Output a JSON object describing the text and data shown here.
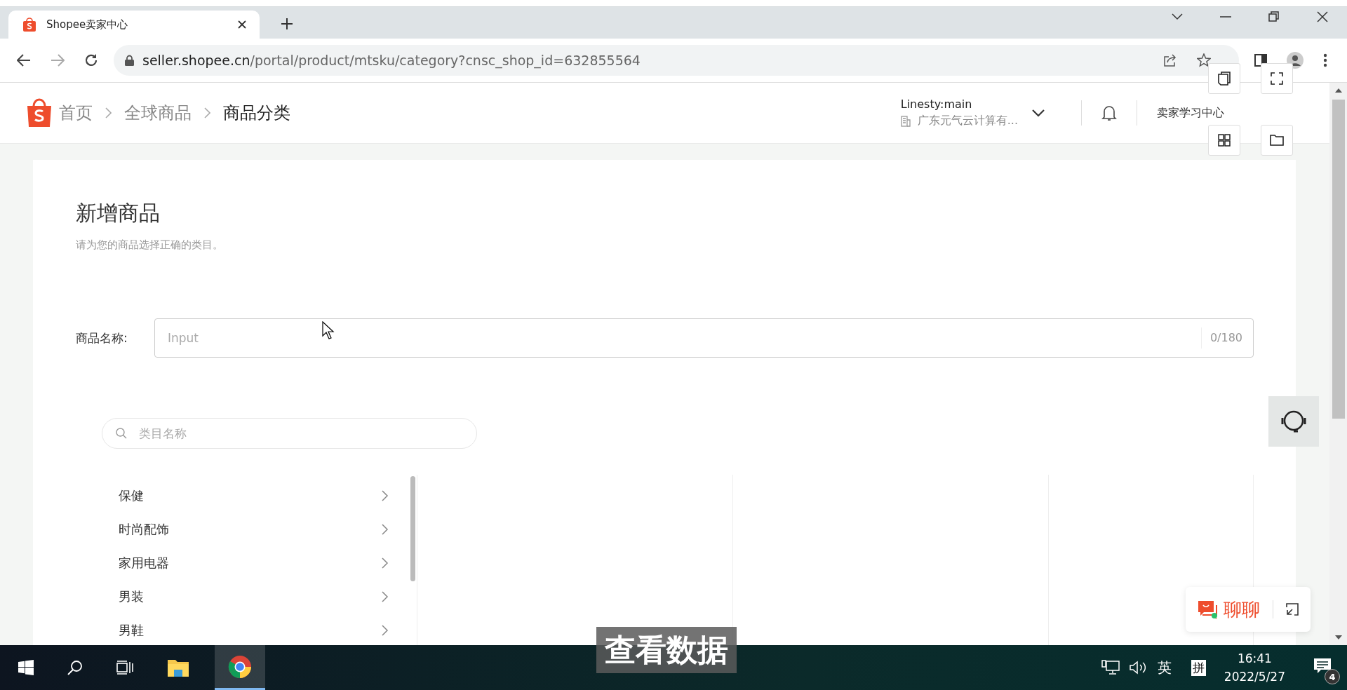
{
  "browser": {
    "tab_title": "Shopee卖家中心",
    "url_host": "seller.shopee.cn",
    "url_path": "/portal/product/mtsku/category?cnsc_shop_id=632855564"
  },
  "header": {
    "breadcrumbs": [
      {
        "label": "首页",
        "current": false
      },
      {
        "label": "全球商品",
        "current": false
      },
      {
        "label": "商品分类",
        "current": true
      }
    ],
    "account": {
      "name": "Linesty:main",
      "company": "广东元气云计算有..."
    },
    "learning_center": "卖家学习中心"
  },
  "page": {
    "title": "新增商品",
    "subtitle": "请为您的商品选择正确的类目。"
  },
  "form": {
    "label": "商品名称:",
    "placeholder": "Input",
    "counter": "0/180"
  },
  "category_search": {
    "placeholder": "类目名称"
  },
  "categories": [
    {
      "label": "保健"
    },
    {
      "label": "时尚配饰"
    },
    {
      "label": "家用电器"
    },
    {
      "label": "男装"
    },
    {
      "label": "男鞋"
    }
  ],
  "chat": {
    "label": "聊聊"
  },
  "caption": "查看数据",
  "taskbar": {
    "ime_lang": "英",
    "ime_mode": "拼",
    "time": "16:41",
    "date": "2022/5/27",
    "notifications": "4"
  }
}
